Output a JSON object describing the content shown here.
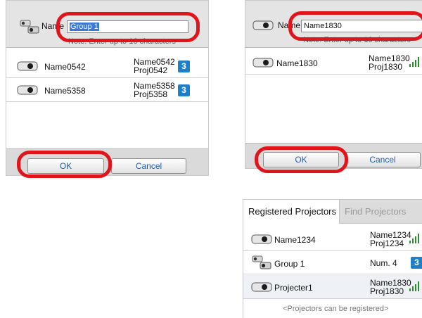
{
  "dialog_left": {
    "name_label": "Name",
    "name_value": "Group 1",
    "note": "Note: Enter up to 16 characters",
    "rows": [
      {
        "name": "Name0542",
        "info_line1": "Name0542",
        "info_line2": "Proj0542",
        "badge": "3"
      },
      {
        "name": "Name5358",
        "info_line1": "Name5358",
        "info_line2": "Proj5358",
        "badge": "3"
      }
    ],
    "ok_label": "OK",
    "cancel_label": "Cancel"
  },
  "dialog_right": {
    "name_label": "Name",
    "name_value": "Name1830",
    "note": "Note: Enter up to 16 characters",
    "rows": [
      {
        "name": "Name1830",
        "info_line1": "Name1830",
        "info_line2": "Proj1830",
        "signal": "strong"
      }
    ],
    "ok_label": "OK",
    "cancel_label": "Cancel"
  },
  "registered_panel": {
    "tabs": [
      {
        "label": "Registered Projectors",
        "active": true
      },
      {
        "label": "Find Projectors",
        "active": false
      }
    ],
    "rows": [
      {
        "name": "Name1234",
        "info_line1": "Name1234",
        "info_line2": "Proj1234",
        "kind": "projector",
        "indicator": "signal"
      },
      {
        "name": "Group 1",
        "info_line1": "Num. 4",
        "kind": "group",
        "indicator": "badge",
        "badge": "3"
      },
      {
        "name": "Projecter1",
        "info_line1": "Name1830",
        "info_line2": "Proj1830",
        "kind": "projector",
        "indicator": "signal"
      }
    ],
    "hint": "<Projectors can be registered>"
  },
  "colors": {
    "highlight_ring": "#e0141b",
    "badge": "#1f80c8",
    "signal": "#2f8a2f",
    "selection": "#3b79d6"
  }
}
